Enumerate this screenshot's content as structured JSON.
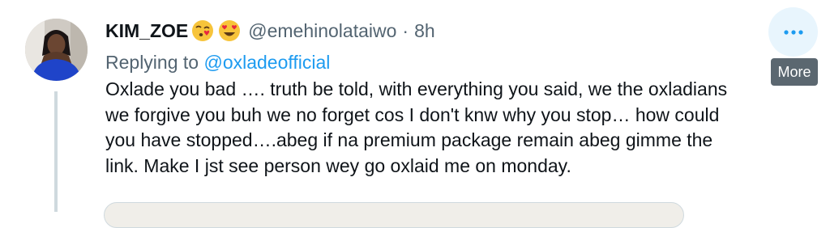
{
  "tweet": {
    "display_name": "KIM_ZOE",
    "emojis": [
      "face-blowing-kiss",
      "smiling-face-with-heart-eyes"
    ],
    "handle": "@emehinolataiwo",
    "separator": "·",
    "time": "8h",
    "replying_prefix": "Replying to ",
    "replying_to": "@oxladeofficial",
    "text_lines": [
      "Oxlade you bad …. truth be told, with everything you said, we the oxladians",
      "we forgive you buh we no forget cos I don't knw why you stop… how could",
      "you have stopped….abeg if na premium package remain abeg gimme the",
      "link. Make I jst see person wey go oxlaid me on monday."
    ]
  },
  "more": {
    "icon": "ellipsis-icon",
    "tooltip": "More"
  },
  "colors": {
    "accent": "#1d9bf0",
    "secondary_text": "#536471",
    "primary_text": "#0f1419",
    "more_hover_bg": "#e8f5fd",
    "tooltip_bg": "#5b6770"
  }
}
